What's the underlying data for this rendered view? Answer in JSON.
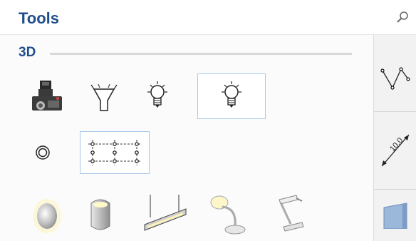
{
  "header": {
    "title": "Tools",
    "search_icon": "search-icon"
  },
  "section": {
    "label": "3D"
  },
  "tools": [
    {
      "name": "camera-tool",
      "icon": "camera-icon"
    },
    {
      "name": "spotlight-tool",
      "icon": "spotlight-icon"
    },
    {
      "name": "light-bulb-tool",
      "icon": "light-bulb-icon"
    },
    {
      "name": "point-light-tool",
      "icon": "point-light-icon",
      "selected": true
    },
    {
      "name": "ring-light-tool",
      "icon": "ring-icon"
    },
    {
      "name": "light-grid-tool",
      "icon": "light-grid-icon",
      "selected": true
    },
    {
      "name": "ceiling-lamp-tool",
      "icon": "ceiling-lamp-icon"
    },
    {
      "name": "wall-lamp-tool",
      "icon": "wall-lamp-icon"
    },
    {
      "name": "pendant-lamp-tool",
      "icon": "pendant-lamp-icon"
    },
    {
      "name": "desk-lamp-tool",
      "icon": "desk-lamp-icon"
    },
    {
      "name": "desk-lamp-angled-tool",
      "icon": "desk-lamp-angled-icon"
    }
  ],
  "rightbar": {
    "items": [
      {
        "name": "polyline-tool",
        "icon": "polyline-icon"
      },
      {
        "name": "dimension-tool",
        "icon": "dimension-icon",
        "label": "10.0"
      },
      {
        "name": "wall-tool",
        "icon": "wall-icon"
      }
    ]
  }
}
